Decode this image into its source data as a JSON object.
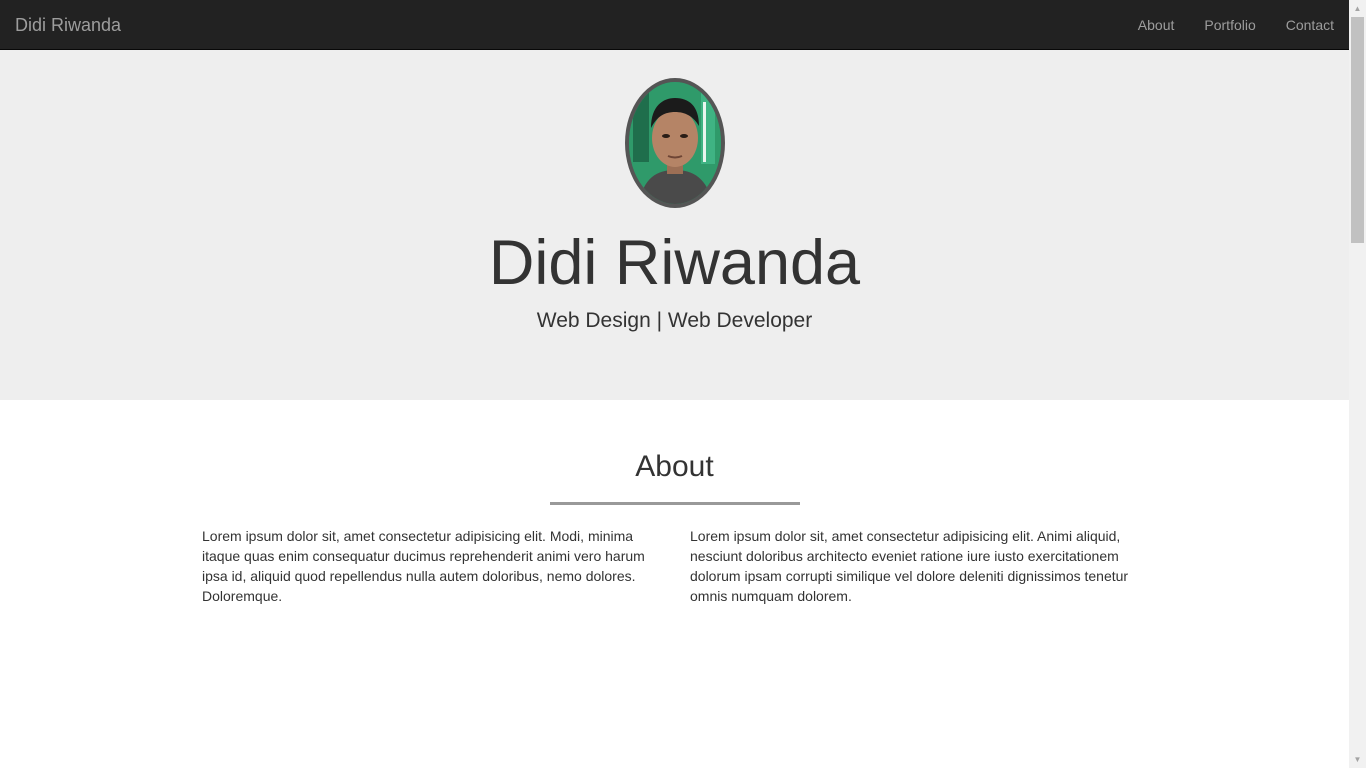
{
  "navbar": {
    "brand": "Didi Riwanda",
    "links": [
      "About",
      "Portfolio",
      "Contact"
    ]
  },
  "hero": {
    "name": "Didi Riwanda",
    "subtitle": "Web Design | Web Developer"
  },
  "about": {
    "title": "About",
    "paragraphs": [
      "Lorem ipsum dolor sit, amet consectetur adipisicing elit. Modi, minima itaque quas enim consequatur ducimus reprehenderit animi vero harum ipsa id, aliquid quod repellendus nulla autem doloribus, nemo dolores. Doloremque.",
      "Lorem ipsum dolor sit, amet consectetur adipisicing elit. Animi aliquid, nesciunt doloribus architecto eveniet ratione iure iusto exercitationem dolorum ipsam corrupti similique vel dolore deleniti dignissimos tenetur omnis numquam dolorem."
    ]
  },
  "colors": {
    "navbar_bg": "#222222",
    "hero_bg": "#eeeeee",
    "nav_text": "#9d9d9d",
    "divider": "#999999",
    "avatar_border": "#555555"
  },
  "icons": {
    "scroll_up": "arrow-up-icon",
    "scroll_down": "arrow-down-icon"
  }
}
